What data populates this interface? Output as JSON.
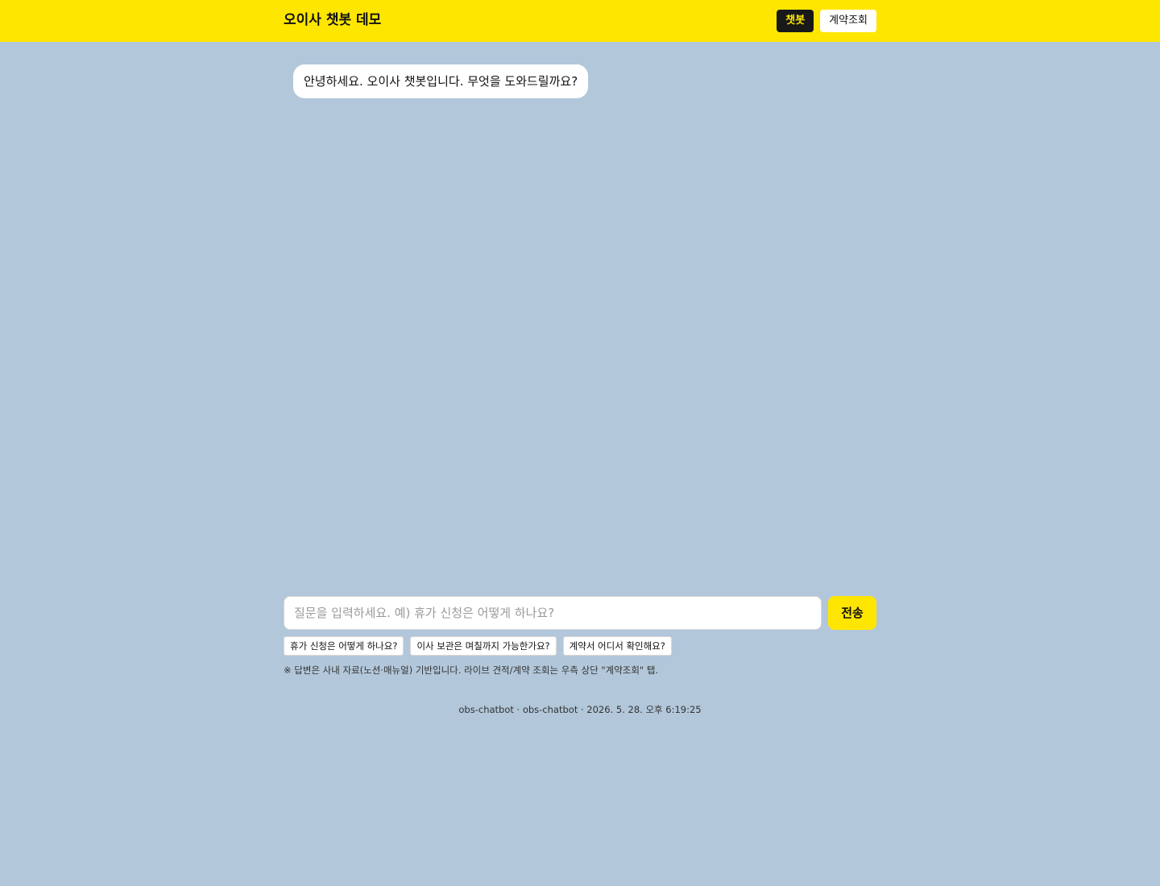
{
  "header": {
    "title": "오이사 챗봇 데모",
    "tabs": [
      {
        "label": "챗봇",
        "active": true
      },
      {
        "label": "계약조회",
        "active": false
      }
    ]
  },
  "chat": {
    "messages": [
      {
        "role": "bot",
        "text": "안녕하세요. 오이사 챗봇입니다. 무엇을 도와드릴까요?"
      }
    ]
  },
  "composer": {
    "placeholder": "질문을 입력하세요. 예) 휴가 신청은 어떻게 하나요?",
    "value": "",
    "send_label": "전송"
  },
  "suggestions": [
    "휴가 신청은 어떻게 하나요?",
    "이사 보관은 며칠까지 가능한가요?",
    "계약서 어디서 확인해요?"
  ],
  "notice": "※ 답변은 사내 자료(노션·매뉴얼) 기반입니다. 라이브 견적/계약 조회는 우측 상단 \"계약조회\" 탭.",
  "footer": "obs-chatbot · obs-chatbot · 2026. 5. 28. 오후 6:19:25",
  "colors": {
    "header_bg": "#ffe600",
    "page_bg": "#b2c7da",
    "active_tab_bg": "#191919",
    "active_tab_text": "#ffe600",
    "send_button_bg": "#ffe600",
    "bubble_bg": "#ffffff"
  }
}
